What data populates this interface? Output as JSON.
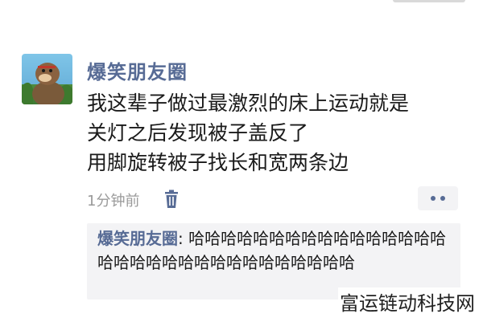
{
  "post": {
    "author": "爆笑朋友圈",
    "content_lines": [
      "我这辈子做过最激烈的床上运动就是",
      "关灯之后发现被子盖反了",
      "用脚旋转被子找长和宽两条边"
    ],
    "time": "1分钟前"
  },
  "comment": {
    "author": "爆笑朋友圈",
    "separator": ": ",
    "text": "哈哈哈哈哈哈哈哈哈哈哈哈哈哈哈哈哈哈哈哈哈哈哈哈哈哈哈哈哈哈哈哈"
  },
  "watermark": "富运链动科技网",
  "icons": {
    "delete": "trash-icon",
    "more": "more-dots-icon"
  },
  "colors": {
    "link": "#576b95",
    "comment_bg": "#f3f3f5",
    "time": "#9a9a9a"
  }
}
